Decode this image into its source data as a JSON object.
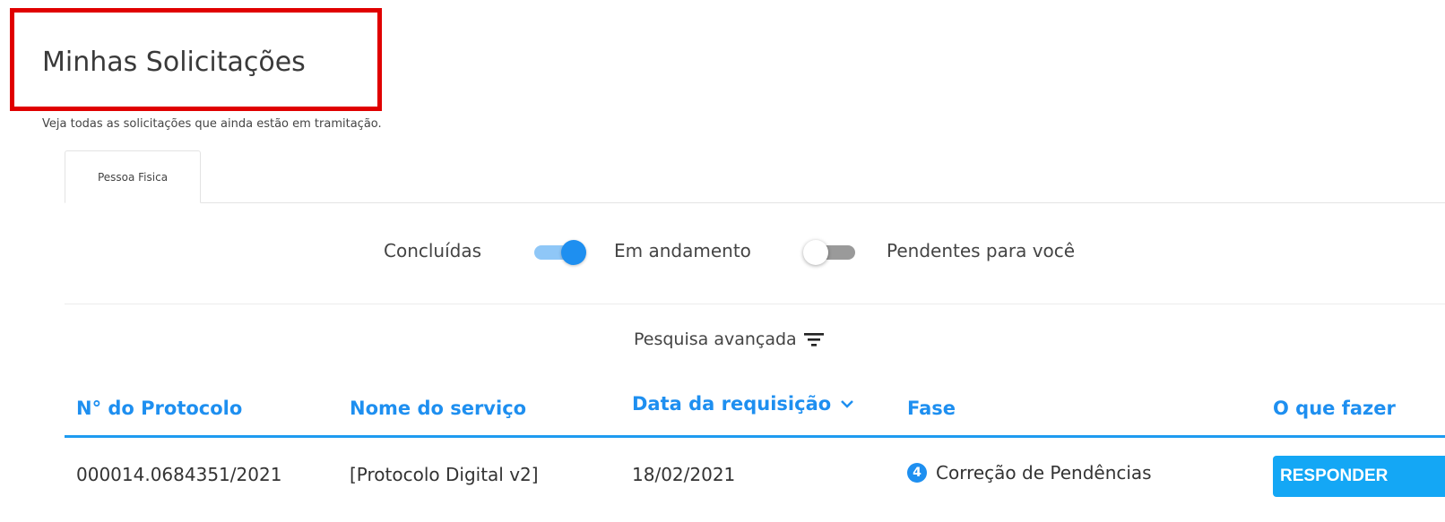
{
  "header": {
    "title": "Minhas Solicitações",
    "subtitle": "Veja todas as solicitações que ainda estão em tramitação."
  },
  "tabs": [
    {
      "label": "Pessoa Fisica",
      "active": true
    }
  ],
  "filters": {
    "concluidas": {
      "label": "Concluídas",
      "on": true
    },
    "em_andamento": {
      "label": "Em andamento",
      "on": false
    },
    "pendentes": {
      "label": "Pendentes para você"
    }
  },
  "advanced_search": {
    "label": "Pesquisa avançada",
    "icon": "filter-icon"
  },
  "table": {
    "columns": {
      "protocolo": "N° do Protocolo",
      "servico": "Nome do serviço",
      "data": "Data da requisição",
      "fase": "Fase",
      "acao": "O que fazer"
    },
    "rows": [
      {
        "protocolo": "000014.0684351/2021",
        "servico": "[Protocolo Digital v2]",
        "data": "18/02/2021",
        "fase_num": "4",
        "fase": "Correção de Pendências",
        "acao": "RESPONDER"
      }
    ]
  },
  "colors": {
    "accent": "#1e8ff0",
    "button": "#14a7f5",
    "highlight": "#e00000"
  }
}
